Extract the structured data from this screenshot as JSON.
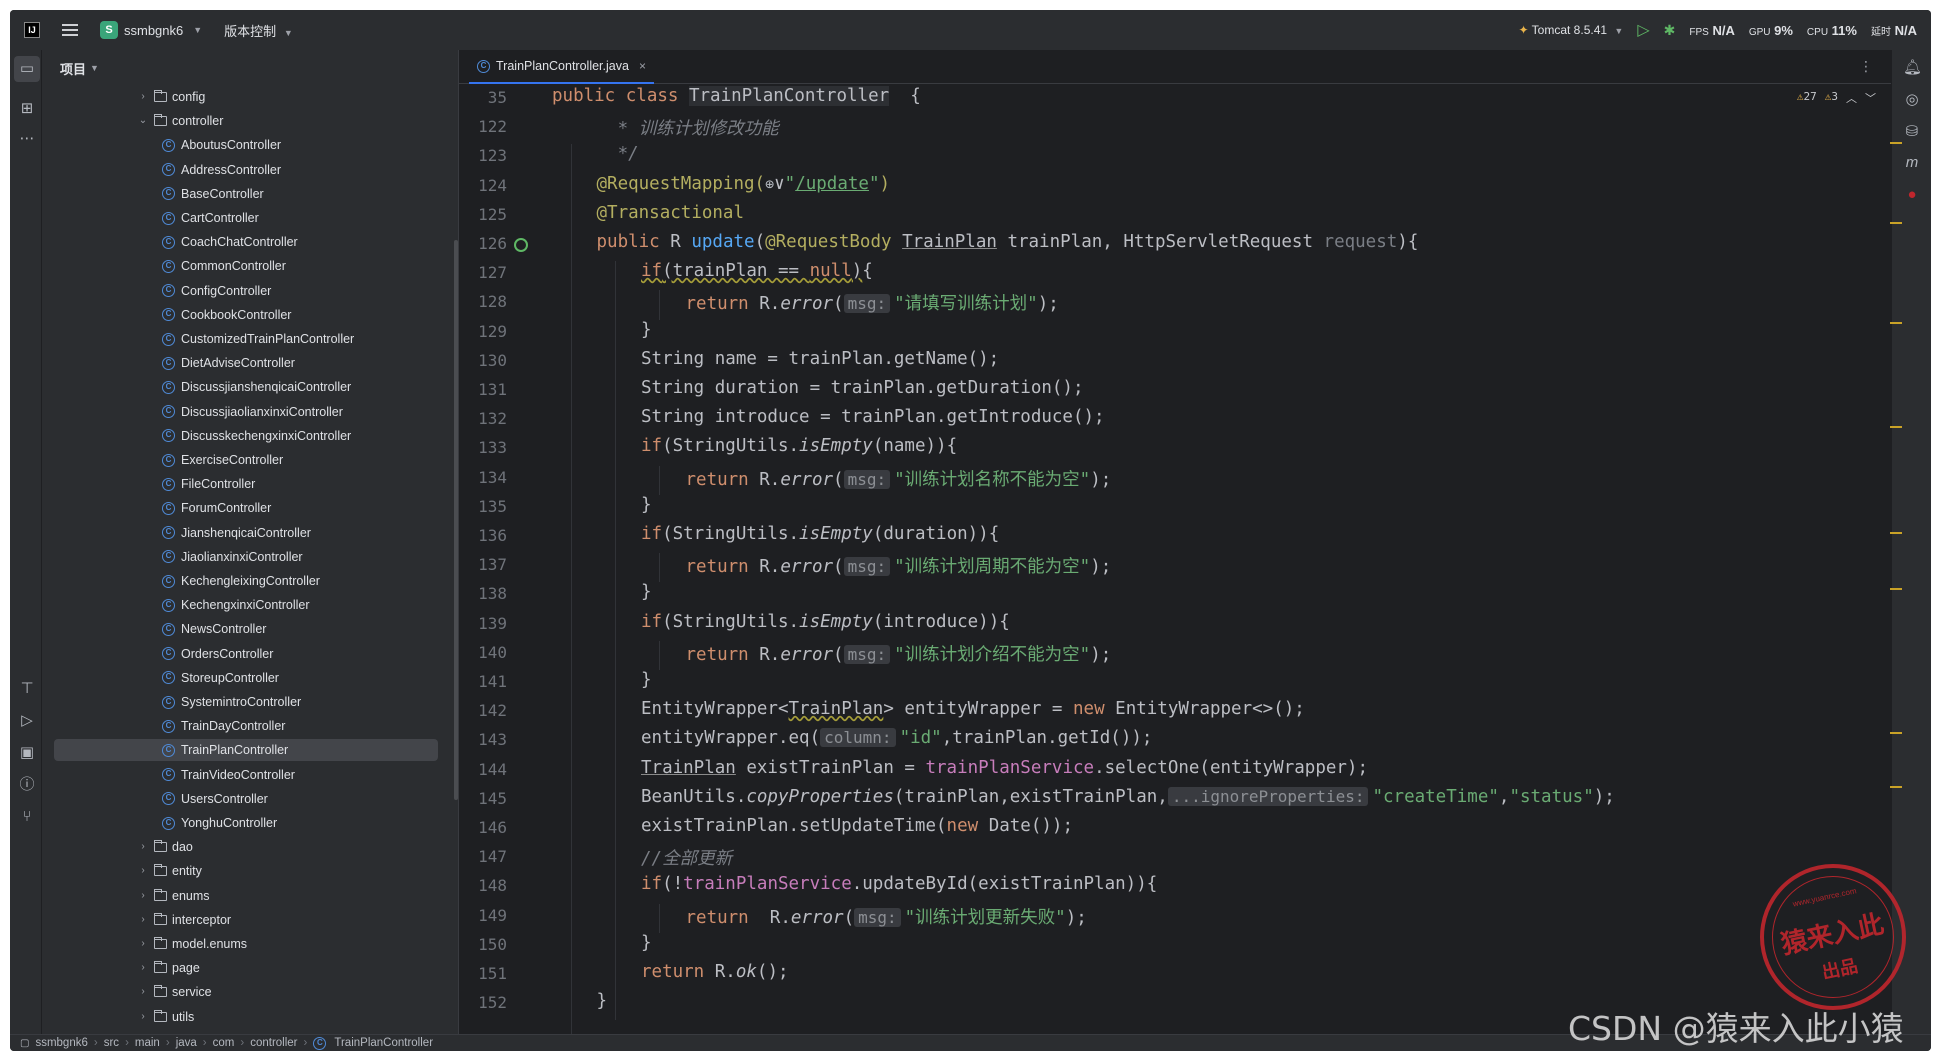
{
  "titlebar": {
    "project_badge": "S",
    "project": "ssmbgnk6",
    "vcs": "版本控制",
    "run_config": "Tomcat 8.5.41",
    "fps_label": "FPS",
    "fps_value": "N/A",
    "gpu_label": "GPU",
    "gpu_value": "9%",
    "cpu_label": "CPU",
    "cpu_value": "11%",
    "time_label": "延时",
    "time_value": "N/A"
  },
  "project_panel": {
    "title": "项目",
    "tree": [
      {
        "label": "config",
        "kind": "folder",
        "expanded": false,
        "depth": 0
      },
      {
        "label": "controller",
        "kind": "folder",
        "expanded": true,
        "depth": 0
      },
      {
        "label": "AboutusController",
        "kind": "class",
        "depth": 1
      },
      {
        "label": "AddressController",
        "kind": "class",
        "depth": 1
      },
      {
        "label": "BaseController",
        "kind": "class",
        "depth": 1
      },
      {
        "label": "CartController",
        "kind": "class",
        "depth": 1
      },
      {
        "label": "CoachChatController",
        "kind": "class",
        "depth": 1
      },
      {
        "label": "CommonController",
        "kind": "class",
        "depth": 1
      },
      {
        "label": "ConfigController",
        "kind": "class",
        "depth": 1
      },
      {
        "label": "CookbookController",
        "kind": "class",
        "depth": 1
      },
      {
        "label": "CustomizedTrainPlanController",
        "kind": "class",
        "depth": 1
      },
      {
        "label": "DietAdviseController",
        "kind": "class",
        "depth": 1
      },
      {
        "label": "DiscussjianshenqicaiController",
        "kind": "class",
        "depth": 1
      },
      {
        "label": "DiscussjiaolianxinxiController",
        "kind": "class",
        "depth": 1
      },
      {
        "label": "DiscusskechengxinxiController",
        "kind": "class",
        "depth": 1
      },
      {
        "label": "ExerciseController",
        "kind": "class",
        "depth": 1
      },
      {
        "label": "FileController",
        "kind": "class",
        "depth": 1
      },
      {
        "label": "ForumController",
        "kind": "class",
        "depth": 1
      },
      {
        "label": "JianshenqicaiController",
        "kind": "class",
        "depth": 1
      },
      {
        "label": "JiaolianxinxiController",
        "kind": "class",
        "depth": 1
      },
      {
        "label": "KechengleixingController",
        "kind": "class",
        "depth": 1
      },
      {
        "label": "KechengxinxiController",
        "kind": "class",
        "depth": 1
      },
      {
        "label": "NewsController",
        "kind": "class",
        "depth": 1
      },
      {
        "label": "OrdersController",
        "kind": "class",
        "depth": 1
      },
      {
        "label": "StoreupController",
        "kind": "class",
        "depth": 1
      },
      {
        "label": "SystemintroController",
        "kind": "class",
        "depth": 1
      },
      {
        "label": "TrainDayController",
        "kind": "class",
        "depth": 1
      },
      {
        "label": "TrainPlanController",
        "kind": "class",
        "depth": 1,
        "selected": true
      },
      {
        "label": "TrainVideoController",
        "kind": "class",
        "depth": 1
      },
      {
        "label": "UsersController",
        "kind": "class",
        "depth": 1
      },
      {
        "label": "YonghuController",
        "kind": "class",
        "depth": 1
      },
      {
        "label": "dao",
        "kind": "folder",
        "expanded": false,
        "depth": 0
      },
      {
        "label": "entity",
        "kind": "folder",
        "expanded": false,
        "depth": 0
      },
      {
        "label": "enums",
        "kind": "folder",
        "expanded": false,
        "depth": 0
      },
      {
        "label": "interceptor",
        "kind": "folder",
        "expanded": false,
        "depth": 0
      },
      {
        "label": "model.enums",
        "kind": "folder",
        "expanded": false,
        "depth": 0
      },
      {
        "label": "page",
        "kind": "folder",
        "expanded": false,
        "depth": 0
      },
      {
        "label": "service",
        "kind": "folder",
        "expanded": false,
        "depth": 0
      },
      {
        "label": "utils",
        "kind": "folder",
        "expanded": false,
        "depth": 0
      }
    ]
  },
  "editor": {
    "tab": "TrainPlanController.java",
    "warnings": "27",
    "weak_warnings": "3",
    "lines": [
      {
        "n": "35",
        "indent": 0,
        "tokens": [
          [
            "kw",
            "public class "
          ],
          [
            "hl",
            "TrainPlanController"
          ],
          [
            "",
            "  {"
          ]
        ]
      },
      {
        "n": "122",
        "indent": 1,
        "tokens": [
          [
            "cm",
            "  * 训练计划修改功能"
          ]
        ]
      },
      {
        "n": "123",
        "indent": 1,
        "tokens": [
          [
            "cm",
            "  */"
          ]
        ]
      },
      {
        "n": "124",
        "indent": 1,
        "tokens": [
          [
            "an",
            "@RequestMapping("
          ],
          [
            "globe",
            "⊕"
          ],
          [
            "",
            "∨"
          ],
          [
            "st",
            "\""
          ],
          [
            "stu",
            "/update"
          ],
          [
            "st",
            "\""
          ],
          [
            "an",
            ")"
          ]
        ]
      },
      {
        "n": "125",
        "indent": 1,
        "tokens": [
          [
            "an",
            "@Transactional"
          ]
        ]
      },
      {
        "n": "126",
        "indent": 1,
        "tokens": [
          [
            "kw",
            "public "
          ],
          [
            "",
            "R "
          ],
          [
            "fn",
            "update"
          ],
          [
            "",
            "("
          ],
          [
            "an",
            "@RequestBody "
          ],
          [
            "ul",
            "TrainPlan"
          ],
          [
            "",
            " trainPlan, HttpServletRequest "
          ],
          [
            "cm2",
            "request"
          ],
          [
            "",
            "){"
          ]
        ]
      },
      {
        "n": "127",
        "indent": 2,
        "tokens": [
          [
            "kwwv",
            "if"
          ],
          [
            "wv",
            "(trainPlan == "
          ],
          [
            "kwwv",
            "null"
          ],
          [
            "wv",
            ")"
          ],
          [
            "",
            "{"
          ]
        ]
      },
      {
        "n": "128",
        "indent": 3,
        "tokens": [
          [
            "kw",
            "return "
          ],
          [
            "",
            "R."
          ],
          [
            "it",
            "error"
          ],
          [
            "",
            "("
          ],
          [
            "hint",
            "msg:"
          ],
          [
            "st",
            "\"请填写训练计划\""
          ],
          [
            "",
            ");"
          ]
        ]
      },
      {
        "n": "129",
        "indent": 2,
        "tokens": [
          [
            "",
            "}"
          ]
        ]
      },
      {
        "n": "130",
        "indent": 2,
        "tokens": [
          [
            "",
            "String name = trainPlan.getName();"
          ]
        ]
      },
      {
        "n": "131",
        "indent": 2,
        "tokens": [
          [
            "",
            "String duration = trainPlan.getDuration();"
          ]
        ]
      },
      {
        "n": "132",
        "indent": 2,
        "tokens": [
          [
            "",
            "String introduce = trainPlan.getIntroduce();"
          ]
        ]
      },
      {
        "n": "133",
        "indent": 2,
        "tokens": [
          [
            "kw",
            "if"
          ],
          [
            "",
            "(StringUtils."
          ],
          [
            "it",
            "isEmpty"
          ],
          [
            "",
            "(name)){"
          ]
        ]
      },
      {
        "n": "134",
        "indent": 3,
        "tokens": [
          [
            "kw",
            "return "
          ],
          [
            "",
            "R."
          ],
          [
            "it",
            "error"
          ],
          [
            "",
            "("
          ],
          [
            "hint",
            "msg:"
          ],
          [
            "st",
            "\"训练计划名称不能为空\""
          ],
          [
            "",
            ");"
          ]
        ]
      },
      {
        "n": "135",
        "indent": 2,
        "tokens": [
          [
            "",
            "}"
          ]
        ]
      },
      {
        "n": "136",
        "indent": 2,
        "tokens": [
          [
            "kw",
            "if"
          ],
          [
            "",
            "(StringUtils."
          ],
          [
            "it",
            "isEmpty"
          ],
          [
            "",
            "(duration)){"
          ]
        ]
      },
      {
        "n": "137",
        "indent": 3,
        "tokens": [
          [
            "kw",
            "return "
          ],
          [
            "",
            "R."
          ],
          [
            "it",
            "error"
          ],
          [
            "",
            "("
          ],
          [
            "hint",
            "msg:"
          ],
          [
            "st",
            "\"训练计划周期不能为空\""
          ],
          [
            "",
            ");"
          ]
        ]
      },
      {
        "n": "138",
        "indent": 2,
        "tokens": [
          [
            "",
            "}"
          ]
        ]
      },
      {
        "n": "139",
        "indent": 2,
        "tokens": [
          [
            "kw",
            "if"
          ],
          [
            "",
            "(StringUtils."
          ],
          [
            "it",
            "isEmpty"
          ],
          [
            "",
            "(introduce)){"
          ]
        ]
      },
      {
        "n": "140",
        "indent": 3,
        "tokens": [
          [
            "kw",
            "return "
          ],
          [
            "",
            "R."
          ],
          [
            "it",
            "error"
          ],
          [
            "",
            "("
          ],
          [
            "hint",
            "msg:"
          ],
          [
            "st",
            "\"训练计划介绍不能为空\""
          ],
          [
            "",
            ");"
          ]
        ]
      },
      {
        "n": "141",
        "indent": 2,
        "tokens": [
          [
            "",
            "}"
          ]
        ]
      },
      {
        "n": "142",
        "indent": 2,
        "tokens": [
          [
            "",
            "EntityWrapper<"
          ],
          [
            "wv",
            "TrainPlan"
          ],
          [
            "",
            "> entityWrapper = "
          ],
          [
            "kw",
            "new "
          ],
          [
            "",
            "EntityWrapper<>();"
          ]
        ]
      },
      {
        "n": "143",
        "indent": 2,
        "tokens": [
          [
            "",
            "entityWrapper.eq("
          ],
          [
            "hint",
            "column:"
          ],
          [
            "st",
            "\"id\""
          ],
          [
            "",
            ",trainPlan.getId());"
          ]
        ]
      },
      {
        "n": "144",
        "indent": 2,
        "tokens": [
          [
            "ul",
            "TrainPlan"
          ],
          [
            "",
            " existTrainPlan = "
          ],
          [
            "fld",
            "trainPlanService"
          ],
          [
            "",
            ".selectOne(entityWrapper);"
          ]
        ]
      },
      {
        "n": "145",
        "indent": 2,
        "tokens": [
          [
            "",
            "BeanUtils."
          ],
          [
            "it",
            "copyProperties"
          ],
          [
            "",
            "(trainPlan,existTrainPlan,"
          ],
          [
            "hint",
            "...ignoreProperties:"
          ],
          [
            "st",
            "\"createTime\""
          ],
          [
            "",
            ","
          ],
          [
            "st",
            "\"status\""
          ],
          [
            "",
            ");"
          ]
        ]
      },
      {
        "n": "146",
        "indent": 2,
        "tokens": [
          [
            "",
            "existTrainPlan.setUpdateTime("
          ],
          [
            "kw",
            "new "
          ],
          [
            "",
            "Date());"
          ]
        ]
      },
      {
        "n": "147",
        "indent": 2,
        "tokens": [
          [
            "cm",
            "//全部更新"
          ]
        ]
      },
      {
        "n": "148",
        "indent": 2,
        "tokens": [
          [
            "kw",
            "if"
          ],
          [
            "",
            "(!"
          ],
          [
            "fld",
            "trainPlanService"
          ],
          [
            "",
            ".updateById(existTrainPlan)){"
          ]
        ]
      },
      {
        "n": "149",
        "indent": 3,
        "tokens": [
          [
            "kw",
            "return  "
          ],
          [
            "",
            "R."
          ],
          [
            "it",
            "error"
          ],
          [
            "",
            "("
          ],
          [
            "hint",
            "msg:"
          ],
          [
            "st",
            "\"训练计划更新失败\""
          ],
          [
            "",
            ");"
          ]
        ]
      },
      {
        "n": "150",
        "indent": 2,
        "tokens": [
          [
            "",
            "}"
          ]
        ]
      },
      {
        "n": "151",
        "indent": 2,
        "tokens": [
          [
            "kw",
            "return "
          ],
          [
            "",
            "R."
          ],
          [
            "it",
            "ok"
          ],
          [
            "",
            "();"
          ]
        ]
      },
      {
        "n": "152",
        "indent": 1,
        "tokens": [
          [
            "",
            "}"
          ]
        ]
      }
    ]
  },
  "breadcrumb": [
    "ssmbgnk6",
    "src",
    "main",
    "java",
    "com",
    "controller",
    "TrainPlanController"
  ],
  "watermark": {
    "csdn": "CSDN @猿来入此小猿",
    "stamp_top": "www.yuanrce.com",
    "stamp_main": "猿来入此",
    "stamp_bottom": "出品"
  },
  "colors": {
    "keyword": "#cf8e6d",
    "annotation": "#b3ae60",
    "string": "#6aab73",
    "function": "#56a8f5",
    "field": "#c77dbb",
    "accent": "#3574f0"
  }
}
